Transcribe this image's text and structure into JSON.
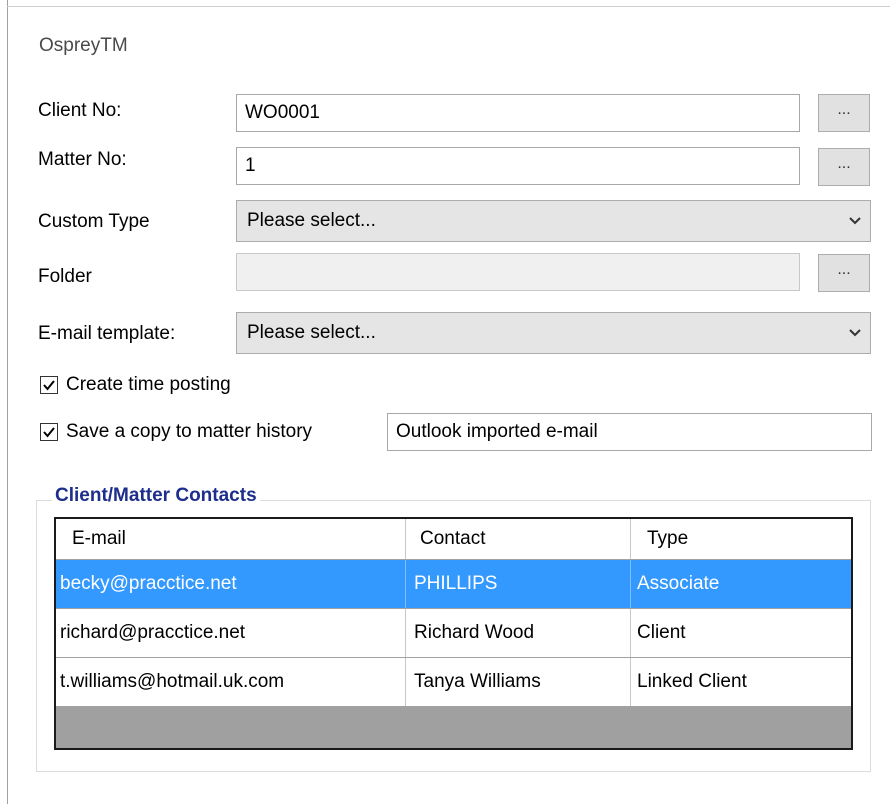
{
  "app": {
    "title": "OspreyTM"
  },
  "form": {
    "client_no": {
      "label": "Client No:",
      "value": "WO0001",
      "browse_label": "..."
    },
    "matter_no": {
      "label": "Matter No:",
      "value": "1",
      "browse_label": "..."
    },
    "custom_type": {
      "label": "Custom Type",
      "value": "Please select..."
    },
    "folder": {
      "label": "Folder",
      "value": "",
      "browse_label": "..."
    },
    "email_template": {
      "label": "E-mail template:",
      "value": "Please select..."
    },
    "create_time_posting": {
      "label": "Create time posting",
      "checked": true
    },
    "save_copy": {
      "label": "Save a copy to matter history",
      "checked": true,
      "description": "Outlook imported e-mail"
    }
  },
  "contacts": {
    "group_title": "Client/Matter Contacts",
    "columns": [
      "E-mail",
      "Contact",
      "Type"
    ],
    "rows": [
      {
        "email": "becky@pracctice.net",
        "contact": "PHILLIPS",
        "type": "Associate",
        "selected": true
      },
      {
        "email": "richard@pracctice.net",
        "contact": "Richard Wood",
        "type": "Client",
        "selected": false
      },
      {
        "email": "t.williams@hotmail.uk.com",
        "contact": "Tanya Williams",
        "type": "Linked Client",
        "selected": false
      }
    ]
  },
  "icons": {
    "checkbox": "check-icon",
    "dropdown": "chevron-down-icon"
  },
  "colors": {
    "selection": "#3399ff",
    "group_title": "#1d2e8c",
    "grid_empty": "#a0a0a0"
  }
}
